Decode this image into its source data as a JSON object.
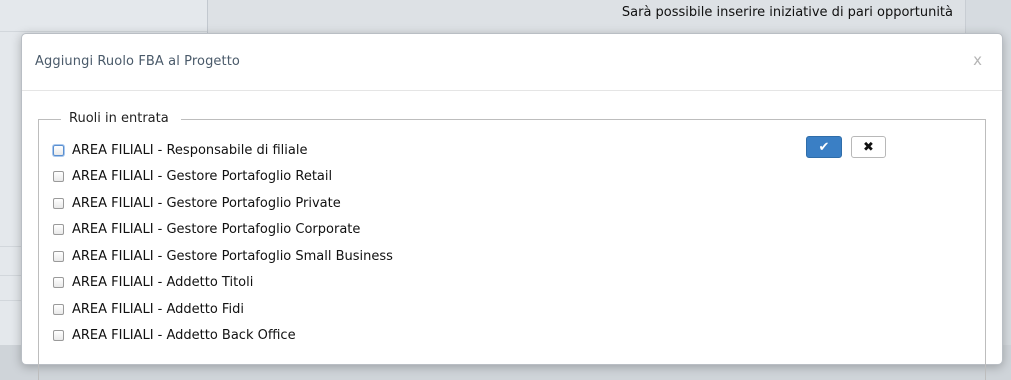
{
  "background": {
    "note_text": "Sarà possibile inserire iniziative di pari opportunità"
  },
  "modal": {
    "title": "Aggiungi Ruolo FBA al Progetto",
    "close_label": "x",
    "fieldset_legend": "Ruoli in entrata",
    "confirm_icon": "✔",
    "cancel_icon": "✖",
    "items": [
      {
        "label": "AREA FILIALI - Responsabile di filiale",
        "checked": false
      },
      {
        "label": "AREA FILIALI - Gestore Portafoglio Retail",
        "checked": false
      },
      {
        "label": "AREA FILIALI - Gestore Portafoglio Private",
        "checked": false
      },
      {
        "label": "AREA FILIALI - Gestore Portafoglio Corporate",
        "checked": false
      },
      {
        "label": "AREA FILIALI - Gestore Portafoglio Small Business",
        "checked": false
      },
      {
        "label": "AREA FILIALI - Addetto Titoli",
        "checked": false
      },
      {
        "label": "AREA FILIALI - Addetto Fidi",
        "checked": false
      },
      {
        "label": "AREA FILIALI - Addetto Back Office",
        "checked": false
      }
    ]
  },
  "colors": {
    "accent": "#3a7fc5",
    "title_text": "#4a5a6a"
  }
}
